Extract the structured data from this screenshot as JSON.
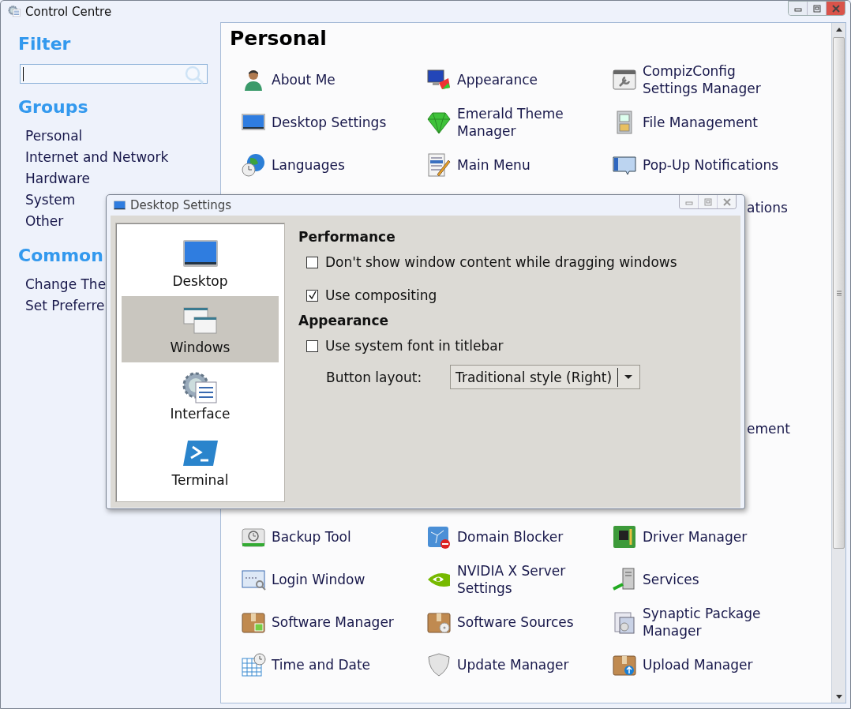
{
  "window": {
    "title": "Control Centre"
  },
  "sidebar": {
    "filter_heading": "Filter",
    "groups_heading": "Groups",
    "groups": [
      {
        "label": "Personal"
      },
      {
        "label": "Internet and Network"
      },
      {
        "label": "Hardware"
      },
      {
        "label": "System"
      },
      {
        "label": "Other"
      }
    ],
    "common_heading": "Common",
    "common_tasks": [
      {
        "label": "Change The"
      },
      {
        "label": "Set Preferre"
      }
    ]
  },
  "content": {
    "heading": "Personal",
    "top_rows": [
      [
        "About Me",
        "Appearance",
        "CompizConfig Settings Manager"
      ],
      [
        "Desktop Settings",
        "Emerald Theme Manager",
        "File Management"
      ],
      [
        "Languages",
        "Main Menu",
        "Pop-Up Notifications"
      ]
    ],
    "partial_labels": [
      "ations",
      "ement"
    ],
    "bottom_rows": [
      [
        "Backup Tool",
        "Domain Blocker",
        "Driver Manager"
      ],
      [
        "Login Window",
        "NVIDIA X Server Settings",
        "Services"
      ],
      [
        "Software Manager",
        "Software Sources",
        "Synaptic Package Manager"
      ],
      [
        "Time and Date",
        "Update Manager",
        "Upload Manager"
      ]
    ]
  },
  "dialog": {
    "title": "Desktop Settings",
    "categories": [
      {
        "label": "Desktop",
        "selected": false
      },
      {
        "label": "Windows",
        "selected": true
      },
      {
        "label": "Interface",
        "selected": false
      },
      {
        "label": "Terminal",
        "selected": false
      }
    ],
    "sections": [
      {
        "heading": "Performance",
        "options": [
          {
            "kind": "checkbox",
            "label": "Don't show window content while dragging windows",
            "checked": false
          },
          {
            "kind": "checkbox",
            "label": "Use compositing",
            "checked": true
          }
        ]
      },
      {
        "heading": "Appearance",
        "options": [
          {
            "kind": "checkbox",
            "label": "Use system font in titlebar",
            "checked": false
          },
          {
            "kind": "dropdown",
            "label": "Button layout:",
            "value": "Traditional style (Right)"
          }
        ]
      }
    ]
  }
}
